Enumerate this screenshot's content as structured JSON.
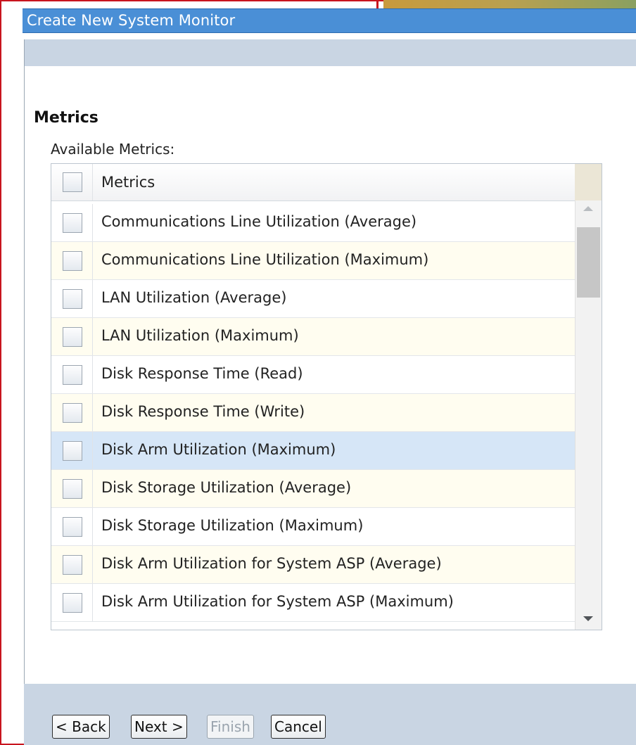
{
  "dialog": {
    "title": "Create New System Monitor"
  },
  "section": {
    "heading": "Metrics",
    "available_label": "Available Metrics:"
  },
  "grid": {
    "column_header": "Metrics",
    "rows": [
      {
        "label": "Communications Line Utilization (Average)",
        "selected": false
      },
      {
        "label": "Communications Line Utilization (Maximum)",
        "selected": false
      },
      {
        "label": "LAN Utilization (Average)",
        "selected": false
      },
      {
        "label": "LAN Utilization (Maximum)",
        "selected": false
      },
      {
        "label": "Disk Response Time (Read)",
        "selected": false
      },
      {
        "label": "Disk Response Time (Write)",
        "selected": false
      },
      {
        "label": "Disk Arm Utilization (Maximum)",
        "selected": true
      },
      {
        "label": "Disk Storage Utilization (Average)",
        "selected": false
      },
      {
        "label": "Disk Storage Utilization (Maximum)",
        "selected": false
      },
      {
        "label": "Disk Arm Utilization for System ASP (Average)",
        "selected": false
      },
      {
        "label": "Disk Arm Utilization for System ASP (Maximum)",
        "selected": false
      }
    ]
  },
  "buttons": {
    "back": "< Back",
    "next": "Next >",
    "finish": "Finish",
    "cancel": "Cancel"
  },
  "colors": {
    "title_bar": "#4a8fd6",
    "panel_header": "#c9d5e3",
    "row_alt": "#fffdf0",
    "row_selected": "#d6e6f7",
    "frame_border": "#c8141e"
  }
}
